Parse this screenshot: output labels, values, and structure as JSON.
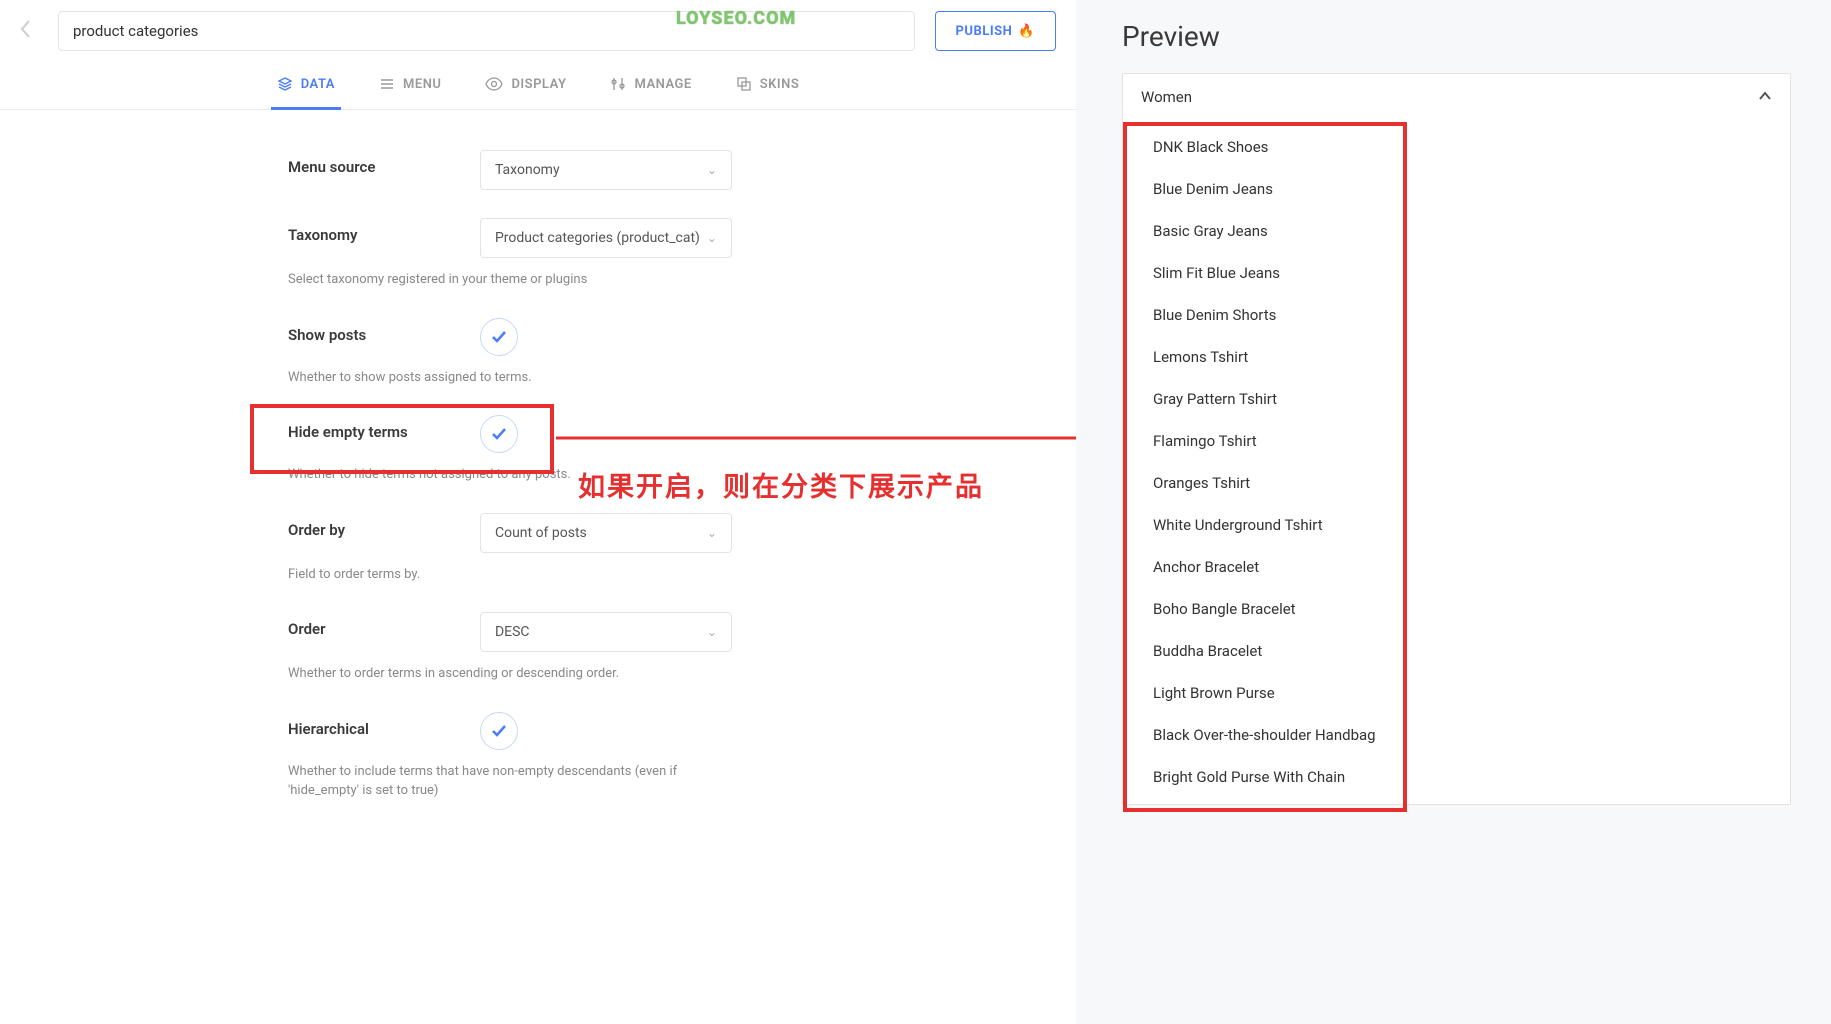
{
  "header": {
    "title_value": "product categories",
    "publish_label": "PUBLISH",
    "publish_icon": "🔥",
    "watermark": "LOYSEO.COM"
  },
  "tabs": [
    {
      "id": "data",
      "label": "DATA",
      "active": true
    },
    {
      "id": "menu",
      "label": "MENU",
      "active": false
    },
    {
      "id": "display",
      "label": "DISPLAY",
      "active": false
    },
    {
      "id": "manage",
      "label": "MANAGE",
      "active": false
    },
    {
      "id": "skins",
      "label": "SKINS",
      "active": false
    }
  ],
  "form": {
    "menu_source": {
      "label": "Menu source",
      "value": "Taxonomy"
    },
    "taxonomy": {
      "label": "Taxonomy",
      "value": "Product categories (product_cat)",
      "help": "Select taxonomy registered in your theme or plugins"
    },
    "show_posts": {
      "label": "Show posts",
      "checked": true,
      "help": "Whether to show posts assigned to terms."
    },
    "hide_empty": {
      "label": "Hide empty terms",
      "checked": true,
      "help": "Whether to hide terms not assigned to any posts."
    },
    "order_by": {
      "label": "Order by",
      "value": "Count of posts",
      "help": "Field to order terms by."
    },
    "order": {
      "label": "Order",
      "value": "DESC",
      "help": "Whether to order terms in ascending or descending order."
    },
    "hierarchical": {
      "label": "Hierarchical",
      "checked": true,
      "help": "Whether to include terms that have non-empty descendants (even if 'hide_empty' is set to true)"
    }
  },
  "annotation": "如果开启，则在分类下展示产品",
  "preview": {
    "title": "Preview",
    "group": "Women",
    "items": [
      "DNK Black Shoes",
      "Blue Denim Jeans",
      "Basic Gray Jeans",
      "Slim Fit Blue Jeans",
      "Blue Denim Shorts",
      "Lemons Tshirt",
      "Gray Pattern Tshirt",
      "Flamingo Tshirt",
      "Oranges Tshirt",
      "White Underground Tshirt",
      "Anchor Bracelet",
      "Boho Bangle Bracelet",
      "Buddha Bracelet",
      "Light Brown Purse",
      "Black Over-the-shoulder Handbag",
      "Bright Gold Purse With Chain"
    ]
  }
}
